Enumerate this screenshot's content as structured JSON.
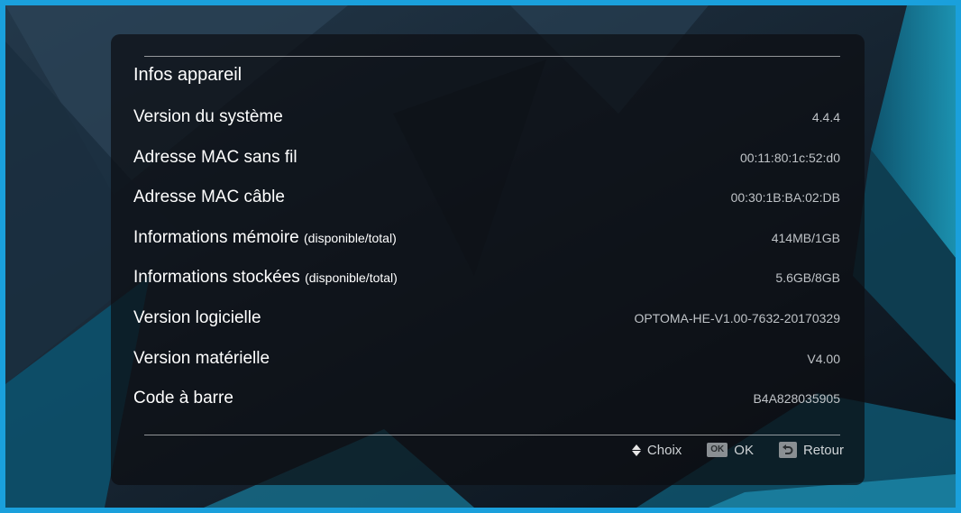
{
  "colors": {
    "accent_border": "#1aa0dc",
    "label_text": "#ffffff",
    "value_text": "#bfc3c7"
  },
  "title": "Infos appareil",
  "rows": [
    {
      "label": "Version du système",
      "sub": "",
      "value": "4.4.4"
    },
    {
      "label": "Adresse MAC sans fil",
      "sub": "",
      "value": "00:11:80:1c:52:d0"
    },
    {
      "label": "Adresse MAC câble",
      "sub": "",
      "value": "00:30:1B:BA:02:DB"
    },
    {
      "label": "Informations mémoire",
      "sub": "(disponible/total)",
      "value": "414MB/1GB"
    },
    {
      "label": "Informations stockées",
      "sub": "(disponible/total)",
      "value": "5.6GB/8GB"
    },
    {
      "label": "Version logicielle",
      "sub": "",
      "value": "OPTOMA-HE-V1.00-7632-20170329"
    },
    {
      "label": "Version matérielle",
      "sub": "",
      "value": "V4.00"
    },
    {
      "label": "Code à barre",
      "sub": "",
      "value": "B4A828035905"
    }
  ],
  "footer": {
    "choose": {
      "icon": "up-down-arrows-icon",
      "label": "Choix"
    },
    "ok": {
      "icon": "ok-key-icon",
      "key_text": "OK",
      "label": "OK"
    },
    "back": {
      "icon": "return-key-icon",
      "label": "Retour"
    }
  }
}
